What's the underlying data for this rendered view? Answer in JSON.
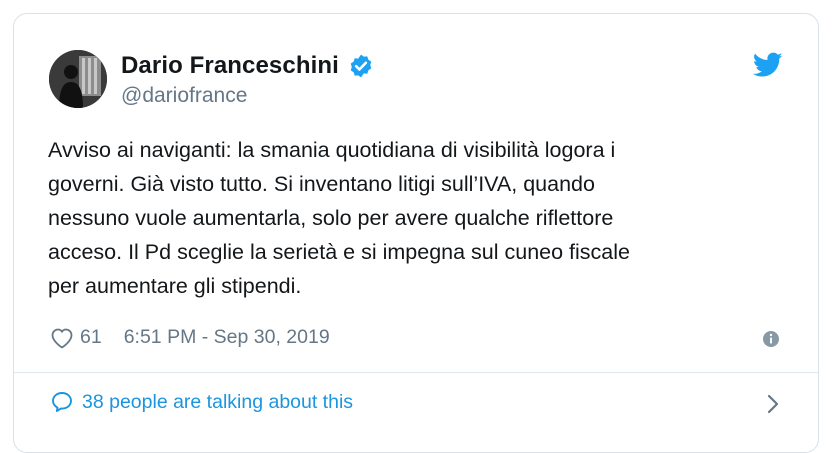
{
  "author": {
    "name": "Dario Franceschini",
    "handle": "@dariofrance",
    "verified": true
  },
  "tweet": {
    "lines": [
      "Avviso ai naviganti: la smania quotidiana di visibilità logora i",
      "governi. Già visto tutto. Si inventano litigi sull’IVA, quando",
      "nessuno vuole aumentarla, solo per avere qualche riflettore",
      "acceso. Il Pd sceglie la serietà e si impegna sul cuneo fiscale",
      "per aumentare gli stipendi."
    ]
  },
  "meta": {
    "likes": "61",
    "timestamp": "6:51 PM - Sep 30, 2019"
  },
  "conversation": {
    "label": "38 people are talking about this"
  },
  "icons": {
    "verified": "verified-badge-icon",
    "bird": "twitter-bird-icon",
    "heart": "heart-icon",
    "info": "info-icon",
    "bubble": "speech-bubble-icon",
    "chevron": "chevron-right-icon"
  },
  "colors": {
    "accent": "#1da1f2",
    "link": "#1b95e0",
    "text": "#14171a",
    "muted": "#657786",
    "border": "#d9e1e8"
  }
}
